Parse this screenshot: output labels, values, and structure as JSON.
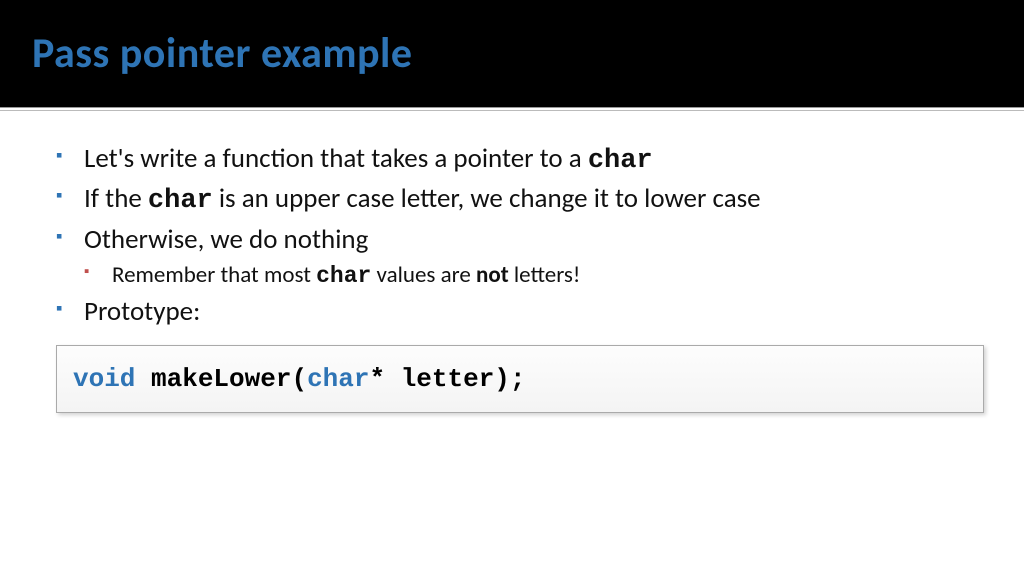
{
  "title": "Pass pointer example",
  "bullets": {
    "b1_pre": "Let's write a function that takes a pointer to a ",
    "b1_code": "char",
    "b2_pre": "If the ",
    "b2_code": "char",
    "b2_post": " is an upper case letter, we change it to lower case",
    "b3": "Otherwise, we do nothing",
    "b3a_pre": "Remember that most ",
    "b3a_code": "char",
    "b3a_mid": " values are ",
    "b3a_bold": "not",
    "b3a_post": " letters!",
    "b4": "Prototype:"
  },
  "code": {
    "kw1": "void",
    "fn": " makeLower(",
    "kw2": "char",
    "rest": "* letter);"
  }
}
